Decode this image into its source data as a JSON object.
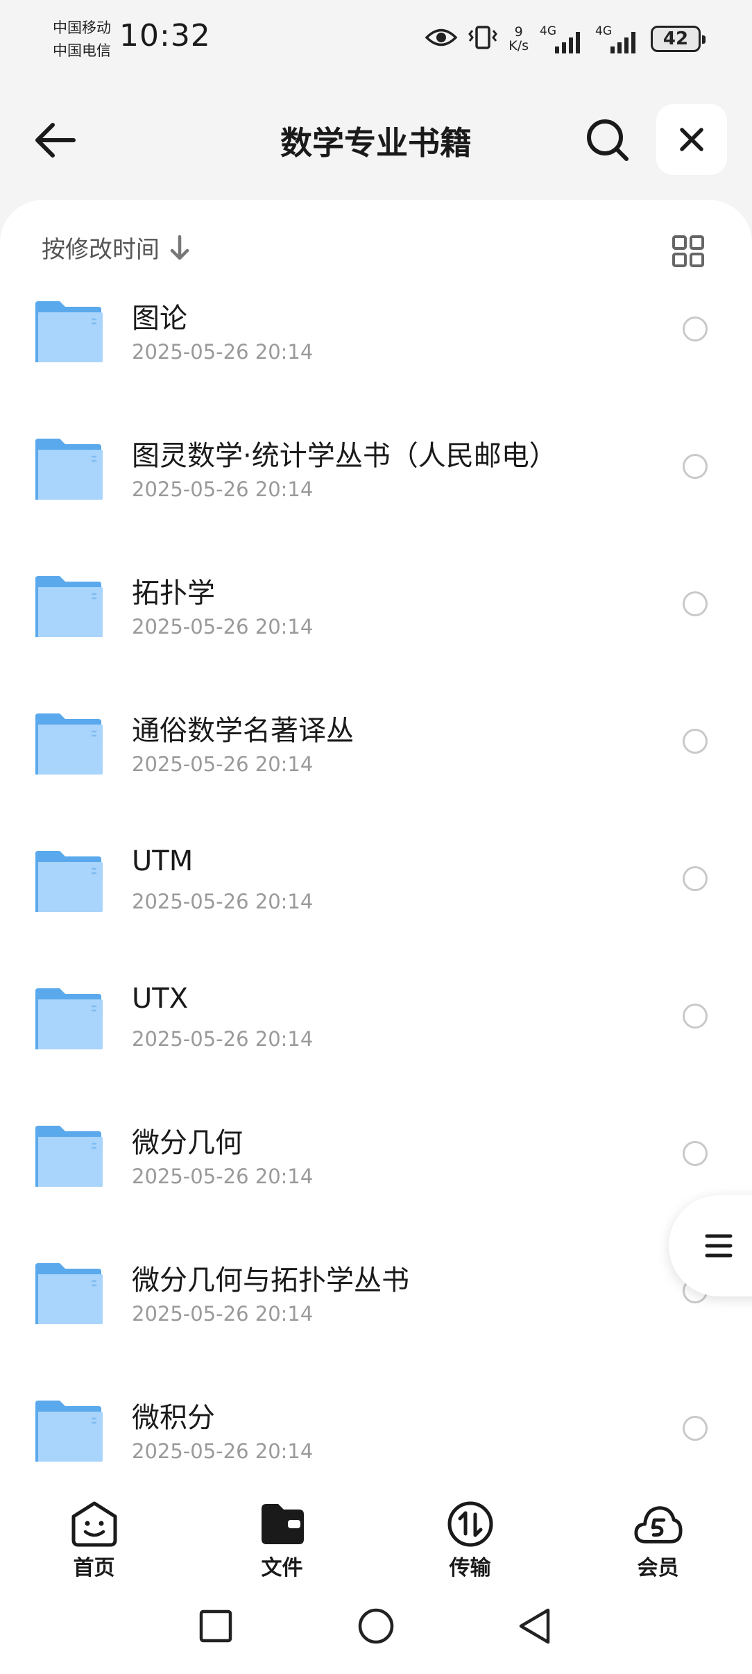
{
  "status_bar": {
    "carrier_1": "中国移动",
    "carrier_2": "中国电信",
    "time": "10:32",
    "net_speed_value": "9",
    "net_speed_unit": "K/s",
    "net_type_1": "4G",
    "net_type_2": "4G",
    "battery": "42"
  },
  "header": {
    "title": "数学专业书籍",
    "back_icon": "arrow-left-icon",
    "search_icon": "search-icon",
    "close_icon": "close-icon"
  },
  "sort": {
    "label": "按修改时间",
    "direction_icon": "arrow-down-icon",
    "view_icon": "grid-view-icon"
  },
  "folders": [
    {
      "name": "图论",
      "date": "2025-05-26 20:14"
    },
    {
      "name": "图灵数学·统计学丛书（人民邮电）",
      "date": "2025-05-26 20:14"
    },
    {
      "name": "拓扑学",
      "date": "2025-05-26 20:14"
    },
    {
      "name": "通俗数学名著译丛",
      "date": "2025-05-26 20:14"
    },
    {
      "name": "UTM",
      "date": "2025-05-26 20:14"
    },
    {
      "name": "UTX",
      "date": "2025-05-26 20:14"
    },
    {
      "name": "微分几何",
      "date": "2025-05-26 20:14"
    },
    {
      "name": "微分几何与拓扑学丛书",
      "date": "2025-05-26 20:14"
    },
    {
      "name": "微积分",
      "date": "2025-05-26 20:14"
    }
  ],
  "tabs": [
    {
      "label": "首页",
      "icon": "smile-face-icon"
    },
    {
      "label": "文件",
      "icon": "folder-wallet-icon",
      "active": true
    },
    {
      "label": "传输",
      "icon": "transfer-arrows-icon"
    },
    {
      "label": "会员",
      "icon": "cloud-s-icon"
    }
  ],
  "colors": {
    "background": "#f4f4f4",
    "panel": "#ffffff",
    "folder_blue": "#5aa9ec",
    "folder_light": "#a9d4fb",
    "date_gray": "#9a9a9a"
  }
}
